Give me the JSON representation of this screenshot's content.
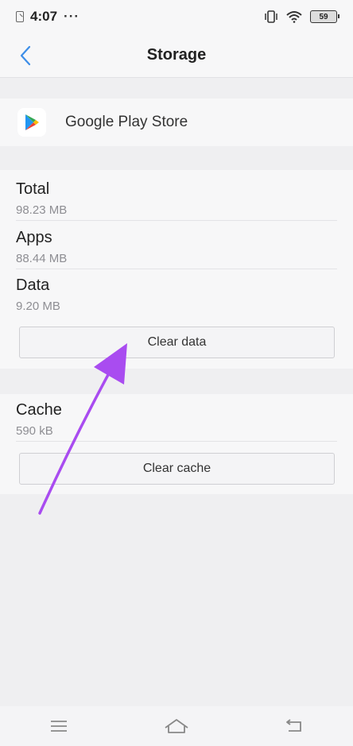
{
  "status_bar": {
    "time": "4:07",
    "dots": "···",
    "battery": "59"
  },
  "header": {
    "title": "Storage"
  },
  "app": {
    "name": "Google Play Store"
  },
  "storage": {
    "total_label": "Total",
    "total_value": "98.23 MB",
    "apps_label": "Apps",
    "apps_value": "88.44 MB",
    "data_label": "Data",
    "data_value": "9.20 MB",
    "clear_data_label": "Clear data"
  },
  "cache": {
    "label": "Cache",
    "value": "590 kB",
    "clear_cache_label": "Clear cache"
  },
  "colors": {
    "accent_back": "#3d8ee8",
    "arrow": "#a94cf0"
  },
  "icons": [
    "sim-icon",
    "vibrate-icon",
    "wifi-icon",
    "battery-icon",
    "back-chevron-icon",
    "play-store-icon",
    "menu-icon",
    "home-icon",
    "back-icon"
  ]
}
